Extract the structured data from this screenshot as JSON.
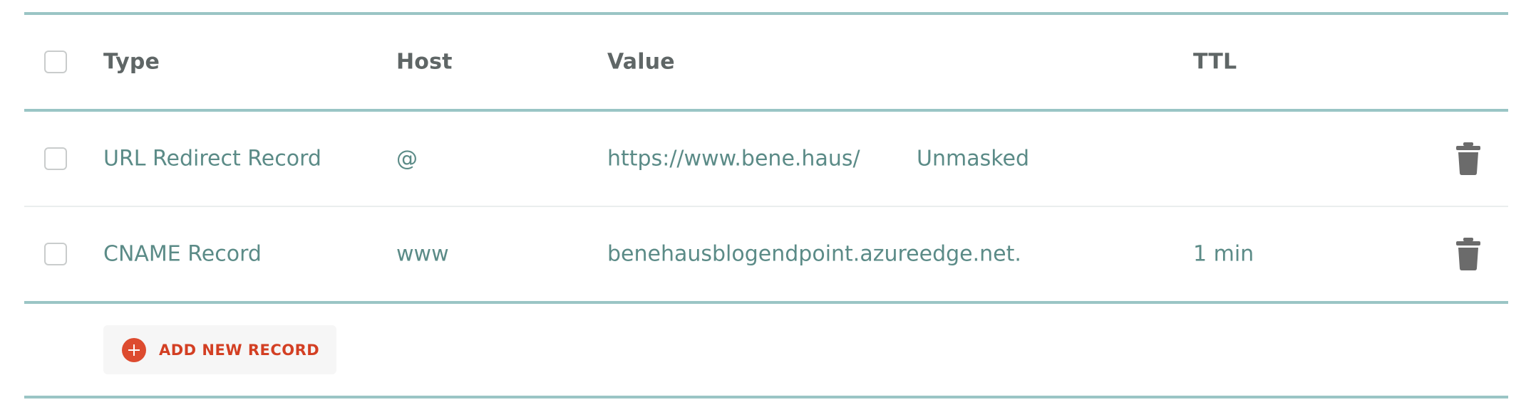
{
  "table": {
    "headers": {
      "type": "Type",
      "host": "Host",
      "value": "Value",
      "ttl": "TTL"
    },
    "rows": [
      {
        "type": "URL Redirect Record",
        "host": "@",
        "value": "https://www.bene.haus/",
        "extra": "Unmasked",
        "ttl": ""
      },
      {
        "type": "CNAME Record",
        "host": "www",
        "value": "benehausblogendpoint.azureedge.net.",
        "extra": "",
        "ttl": "1 min"
      }
    ]
  },
  "actions": {
    "add_label": "ADD NEW RECORD"
  },
  "icons": {
    "delete": "trash-icon",
    "add": "plus-circle-icon"
  },
  "colors": {
    "rule": "#9ac5c5",
    "link_text": "#5b8b87",
    "accent": "#dd4b2f"
  }
}
